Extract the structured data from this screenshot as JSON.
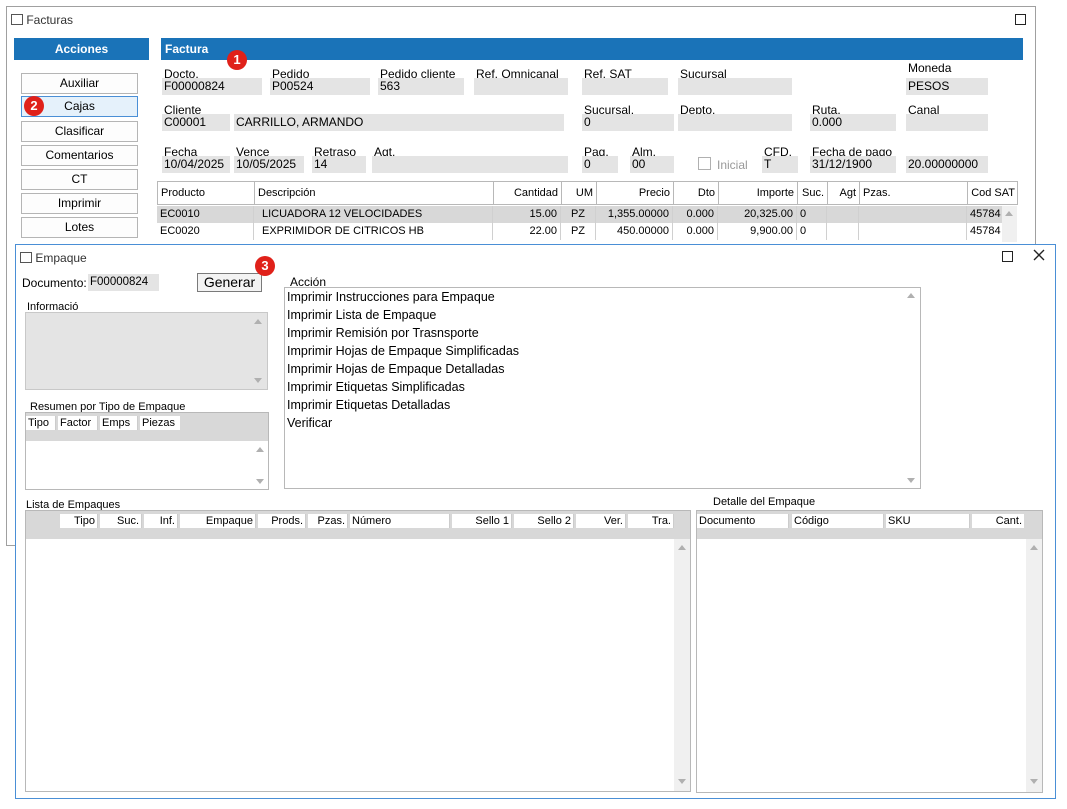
{
  "facturas_window": {
    "title": "Facturas",
    "sidebar": {
      "header": "Acciones",
      "buttons": [
        "Auxiliar",
        "Cajas",
        "Clasificar",
        "Comentarios",
        "CT",
        "Imprimir",
        "Lotes"
      ]
    },
    "factura": {
      "header": "Factura",
      "docto_label": "Docto.",
      "docto_value": "F00000824",
      "pedido_label": "Pedido",
      "pedido_value": "P00524",
      "pedido_cliente_label": "Pedido cliente",
      "pedido_cliente_value": "563",
      "ref_omnicanal_label": "Ref. Omnicanal",
      "ref_omnicanal_value": "",
      "ref_sat_label": "Ref. SAT",
      "ref_sat_value": "",
      "sucursal_label": "Sucursal",
      "sucursal_value": "",
      "moneda_label": "Moneda",
      "moneda_value": "PESOS",
      "cliente_label": "Cliente",
      "cliente_code": "C00001",
      "cliente_name": "CARRILLO, ARMANDO",
      "sucursal2_label": "Sucursal.",
      "sucursal2_value": "0",
      "depto_label": "Depto.",
      "depto_value": "",
      "ruta_label": "Ruta.",
      "ruta_value": "0.000",
      "canal_label": "Canal",
      "canal_value": "",
      "fecha_label": "Fecha",
      "fecha_value": "10/04/2025",
      "vence_label": "Vence",
      "vence_value": "10/05/2025",
      "retraso_label": "Retraso",
      "retraso_value": "14",
      "agt_label": "Agt.",
      "agt_value": "",
      "pag_label": "Pag.",
      "pag_value": "0",
      "alm_label": "Alm.",
      "alm_value": "00",
      "inicial_label": "Inicial",
      "cfd_label": "CFD.",
      "cfd_value": "T",
      "fecha_pago_label": "Fecha de pago",
      "fecha_pago_value": "31/12/1900",
      "tipo_cambio_value": "20.00000000"
    },
    "grid": {
      "columns": [
        "Producto",
        "Descripción",
        "Cantidad",
        "UM",
        "Precio",
        "Dto",
        "Importe",
        "Suc.",
        "Agt",
        "Pzas.",
        "Cod SAT"
      ],
      "rows": [
        [
          "EC0010",
          "LICUADORA 12 VELOCIDADES",
          "15.00",
          "PZ",
          "1,355.00000",
          "0.000",
          "20,325.00",
          "0",
          "",
          "",
          "45784"
        ],
        [
          "EC0020",
          "EXPRIMIDOR DE CITRICOS HB",
          "22.00",
          "PZ",
          "450.00000",
          "0.000",
          "9,900.00",
          "0",
          "",
          "",
          "45784"
        ]
      ]
    }
  },
  "empaque_window": {
    "title": "Empaque",
    "documento_label": "Documento:",
    "documento_value": "F00000824",
    "generar_label": "Generar",
    "informacion_label": "Informació",
    "resumen_label": "Resumen por Tipo de Empaque",
    "resumen_columns": [
      "Tipo",
      "Factor",
      "Emps",
      "Piezas"
    ],
    "accion_label": "Acción",
    "acciones": [
      "Imprimir Instrucciones para Empaque",
      "Imprimir Lista de Empaque",
      "Imprimir Remisión por Trasnsporte",
      "Imprimir Hojas de Empaque Simplificadas",
      "Imprimir Hojas de Empaque Detalladas",
      "Imprimir Etiquetas Simplificadas",
      "Imprimir Etiquetas Detalladas",
      "Verificar"
    ],
    "lista_label": "Lista de Empaques",
    "lista_columns": [
      "Tipo",
      "Suc.",
      "Inf.",
      "Empaque",
      "Prods.",
      "Pzas.",
      "Número",
      "Sello 1",
      "Sello 2",
      "Ver.",
      "Tra."
    ],
    "detalle_label": "Detalle del Empaque",
    "detalle_columns": [
      "Documento",
      "Código",
      "SKU",
      "Cant."
    ]
  },
  "badges": [
    "1",
    "2",
    "3"
  ],
  "colors": {
    "accent_blue": "#1a73b8",
    "badge_red": "#e0211a",
    "field_gray": "#e4e4e4"
  }
}
